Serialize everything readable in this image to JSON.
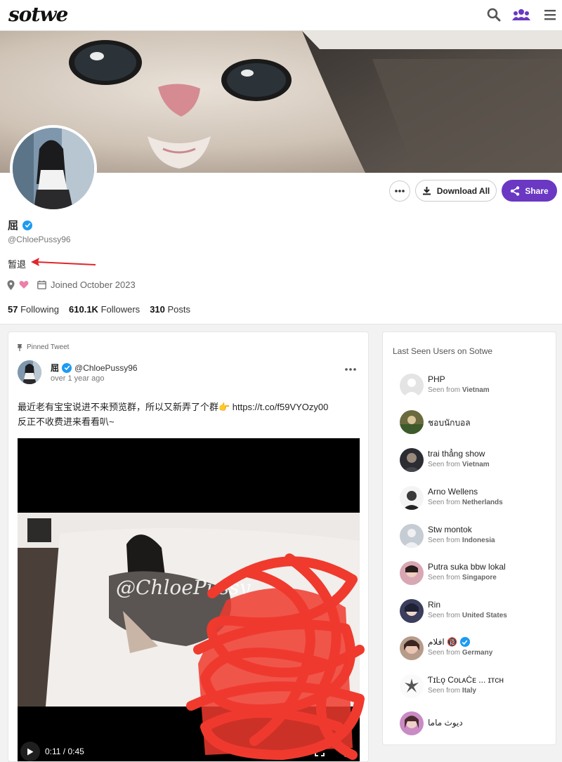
{
  "nav": {
    "logo": "sotwe"
  },
  "profile": {
    "display_name": "屈",
    "handle": "@ChloePussy96",
    "bio": "暂退",
    "joined": "Joined October 2023",
    "stats": {
      "following_count": "57",
      "following_label": "Following",
      "followers_count": "610.1K",
      "followers_label": "Followers",
      "posts_count": "310",
      "posts_label": "Posts"
    },
    "buttons": {
      "download_all": "Download All",
      "share": "Share"
    }
  },
  "tweet": {
    "pinned_label": "Pinned Tweet",
    "author_name": "屈",
    "author_handle": "@ChloePussy96",
    "time": "over 1 year ago",
    "text_line1": "最近老有宝宝说进不来预览群，所以又新弄了个群👉 https://t.co/f59VYOzy00",
    "text_line2": "反正不收费进来看看叭~",
    "video": {
      "watermark": "@ChloePussy",
      "timecode": "0:11 / 0:45"
    }
  },
  "sidebar": {
    "title": "Last Seen Users on Sotwe",
    "seen_from_label": "Seen from",
    "users": [
      {
        "name": "PHP",
        "country": "Vietnam"
      },
      {
        "name": "ชอบนักบอล",
        "country": ""
      },
      {
        "name": "trai thẳng show",
        "country": "Vietnam"
      },
      {
        "name": "Arno Wellens",
        "country": "Netherlands"
      },
      {
        "name": "Stw montok",
        "country": "Indonesia"
      },
      {
        "name": "Putra suka bbw lokal",
        "country": "Singapore"
      },
      {
        "name": "Rin",
        "country": "United States"
      },
      {
        "name": "افلام 🔞",
        "country": "Germany"
      },
      {
        "name": "ƬɪĿǫ CoʟᴀĊᴇ ... ɪᴛᴄʜ",
        "country": "Italy"
      },
      {
        "name": "ديوث ماما",
        "country": ""
      }
    ]
  },
  "colors": {
    "accent": "#6a38c2",
    "verified": "#1d9bf0",
    "arrow": "#e0262b",
    "scribble": "#f03a2e"
  }
}
